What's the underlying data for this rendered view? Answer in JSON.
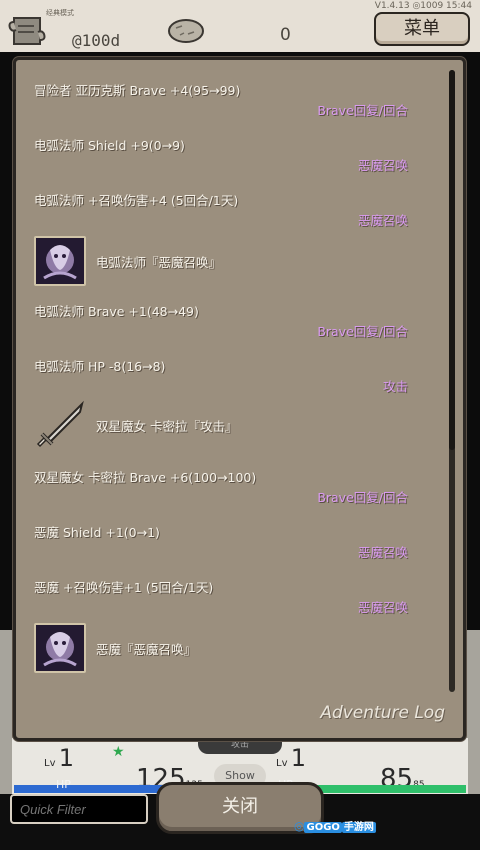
{
  "topbar": {
    "mode_label": "经典模式",
    "version_label": "V1.4.13  ◎1009  15:44",
    "money": "@100d",
    "stone_count": "0",
    "menu_label": "菜单"
  },
  "log": {
    "title": "Adventure Log",
    "entries": [
      {
        "text": "冒险者 亚历克斯 Brave +4(95→99)",
        "tag": "Brave回复/回合"
      },
      {
        "text": "电弧法师 Shield +9(0→9)",
        "tag": "恶魔召唤"
      },
      {
        "text": "电弧法师 +召唤伤害+4 (5回合/1天)",
        "tag": "恶魔召唤"
      },
      {
        "text": "电弧法师『恶魔召唤』",
        "icon": "demon-portrait-icon"
      },
      {
        "text": "电弧法师 Brave +1(48→49)",
        "tag": "Brave回复/回合"
      },
      {
        "text": "电弧法师 HP -8(16→8)",
        "tag": "攻击"
      },
      {
        "text": "双星魔女 卡密拉『攻击』",
        "icon": "sword-icon"
      },
      {
        "text": "双星魔女 卡密拉 Brave +6(100→100)",
        "tag": "Brave回复/回合"
      },
      {
        "text": "恶魔 Shield +1(0→1)",
        "tag": "恶魔召唤"
      },
      {
        "text": "恶魔 +召唤伤害+1 (5回合/1天)",
        "tag": "恶魔召唤"
      },
      {
        "text": "恶魔『恶魔召唤』",
        "icon": "demon-portrait-icon"
      }
    ]
  },
  "status": {
    "lv_label_left": "Lv",
    "lv_value_left": "1",
    "lv_label_right": "Lv",
    "lv_value_right": "1",
    "hp_label_left": "HP",
    "hp_label_right": "HP",
    "hp_left": "125",
    "hp_left_max": "125",
    "hp_right": "85",
    "hp_right_max": "85",
    "center_tab_label": "攻击",
    "show_label": "Show"
  },
  "bottom": {
    "filter_placeholder": "Quick Filter",
    "close_label": "关闭",
    "watermark_main": "GOGO",
    "watermark_sub": "手游网"
  },
  "colors": {
    "dialog_bg": "#9b8f7e",
    "tag_color": "#d99af0",
    "hp_left_bar": "#2d6ad1",
    "hp_right_bar": "#2fbf6a"
  }
}
